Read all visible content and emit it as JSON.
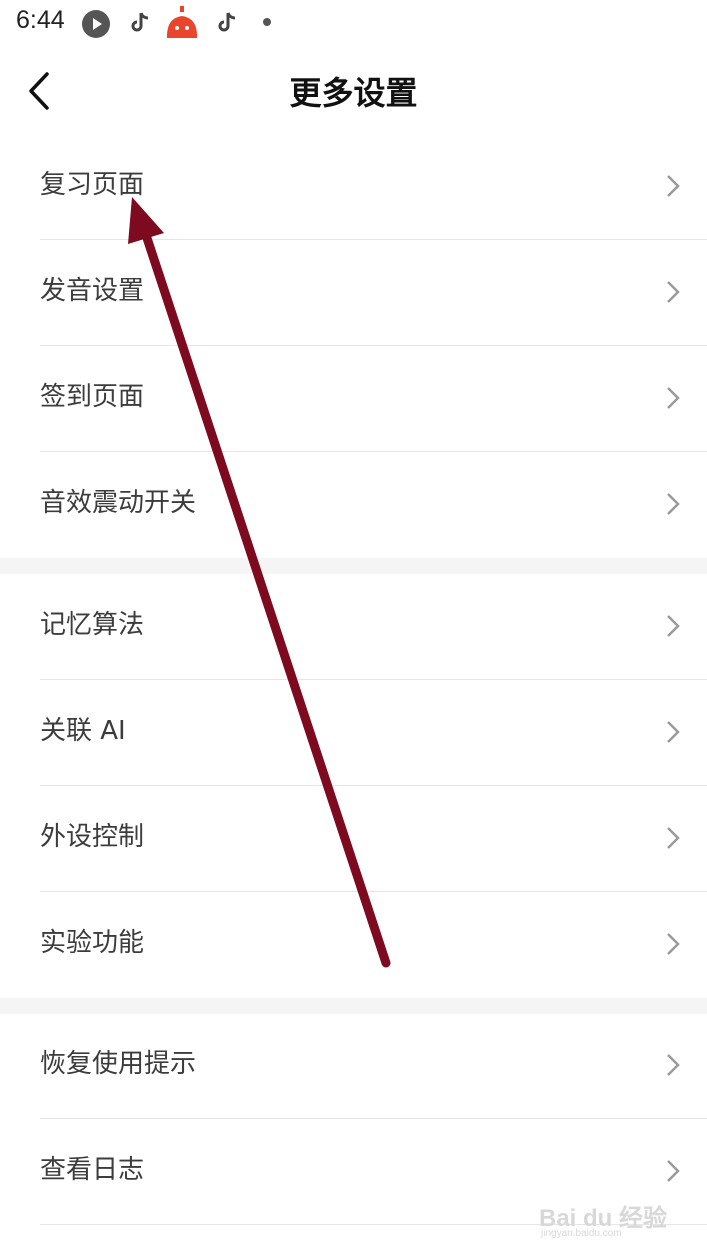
{
  "status_bar": {
    "time": "6:44"
  },
  "header": {
    "title": "更多设置"
  },
  "groups": [
    {
      "items": [
        {
          "label": "复习页面"
        },
        {
          "label": "发音设置"
        },
        {
          "label": "签到页面"
        },
        {
          "label": "音效震动开关"
        }
      ]
    },
    {
      "items": [
        {
          "label": "记忆算法"
        },
        {
          "label": "关联 AI"
        },
        {
          "label": "外设控制"
        },
        {
          "label": "实验功能"
        }
      ]
    },
    {
      "items": [
        {
          "label": "恢复使用提示"
        },
        {
          "label": "查看日志"
        }
      ]
    }
  ],
  "annotation": {
    "color": "#7d0a1e",
    "icon": "pointer-arrow"
  },
  "watermark": {
    "brand": "Bai du 经验",
    "url": "jingyan.baidu.com"
  }
}
